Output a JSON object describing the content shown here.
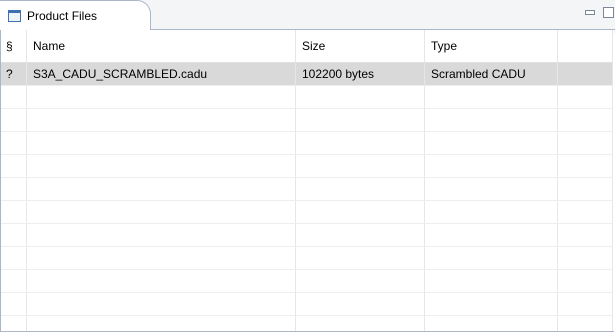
{
  "view": {
    "tab_label": "Product Files"
  },
  "table": {
    "headers": [
      "§",
      "Name",
      "Size",
      "Type",
      ""
    ],
    "rows": [
      [
        "?",
        "S3A_CADU_SCRAMBLED.cadu",
        "102200 bytes",
        "Scrambled CADU",
        ""
      ]
    ],
    "empty_row_count": 11
  }
}
